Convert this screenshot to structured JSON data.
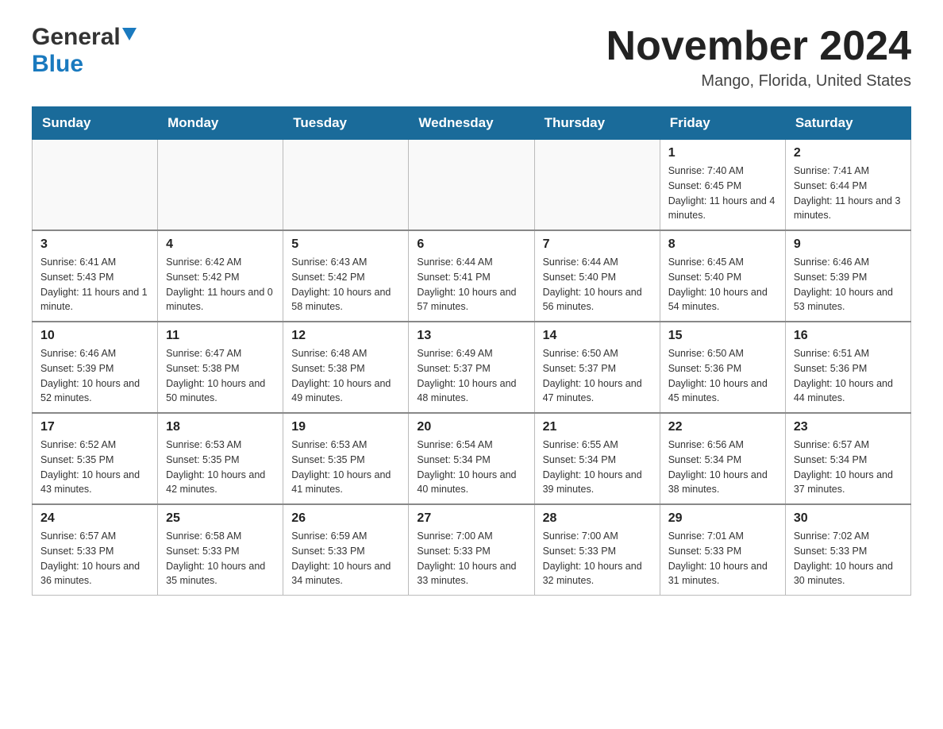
{
  "header": {
    "logo_general": "General",
    "logo_blue": "Blue",
    "month_title": "November 2024",
    "location": "Mango, Florida, United States"
  },
  "weekdays": [
    "Sunday",
    "Monday",
    "Tuesday",
    "Wednesday",
    "Thursday",
    "Friday",
    "Saturday"
  ],
  "rows": [
    [
      {
        "day": "",
        "info": ""
      },
      {
        "day": "",
        "info": ""
      },
      {
        "day": "",
        "info": ""
      },
      {
        "day": "",
        "info": ""
      },
      {
        "day": "",
        "info": ""
      },
      {
        "day": "1",
        "info": "Sunrise: 7:40 AM\nSunset: 6:45 PM\nDaylight: 11 hours and 4 minutes."
      },
      {
        "day": "2",
        "info": "Sunrise: 7:41 AM\nSunset: 6:44 PM\nDaylight: 11 hours and 3 minutes."
      }
    ],
    [
      {
        "day": "3",
        "info": "Sunrise: 6:41 AM\nSunset: 5:43 PM\nDaylight: 11 hours and 1 minute."
      },
      {
        "day": "4",
        "info": "Sunrise: 6:42 AM\nSunset: 5:42 PM\nDaylight: 11 hours and 0 minutes."
      },
      {
        "day": "5",
        "info": "Sunrise: 6:43 AM\nSunset: 5:42 PM\nDaylight: 10 hours and 58 minutes."
      },
      {
        "day": "6",
        "info": "Sunrise: 6:44 AM\nSunset: 5:41 PM\nDaylight: 10 hours and 57 minutes."
      },
      {
        "day": "7",
        "info": "Sunrise: 6:44 AM\nSunset: 5:40 PM\nDaylight: 10 hours and 56 minutes."
      },
      {
        "day": "8",
        "info": "Sunrise: 6:45 AM\nSunset: 5:40 PM\nDaylight: 10 hours and 54 minutes."
      },
      {
        "day": "9",
        "info": "Sunrise: 6:46 AM\nSunset: 5:39 PM\nDaylight: 10 hours and 53 minutes."
      }
    ],
    [
      {
        "day": "10",
        "info": "Sunrise: 6:46 AM\nSunset: 5:39 PM\nDaylight: 10 hours and 52 minutes."
      },
      {
        "day": "11",
        "info": "Sunrise: 6:47 AM\nSunset: 5:38 PM\nDaylight: 10 hours and 50 minutes."
      },
      {
        "day": "12",
        "info": "Sunrise: 6:48 AM\nSunset: 5:38 PM\nDaylight: 10 hours and 49 minutes."
      },
      {
        "day": "13",
        "info": "Sunrise: 6:49 AM\nSunset: 5:37 PM\nDaylight: 10 hours and 48 minutes."
      },
      {
        "day": "14",
        "info": "Sunrise: 6:50 AM\nSunset: 5:37 PM\nDaylight: 10 hours and 47 minutes."
      },
      {
        "day": "15",
        "info": "Sunrise: 6:50 AM\nSunset: 5:36 PM\nDaylight: 10 hours and 45 minutes."
      },
      {
        "day": "16",
        "info": "Sunrise: 6:51 AM\nSunset: 5:36 PM\nDaylight: 10 hours and 44 minutes."
      }
    ],
    [
      {
        "day": "17",
        "info": "Sunrise: 6:52 AM\nSunset: 5:35 PM\nDaylight: 10 hours and 43 minutes."
      },
      {
        "day": "18",
        "info": "Sunrise: 6:53 AM\nSunset: 5:35 PM\nDaylight: 10 hours and 42 minutes."
      },
      {
        "day": "19",
        "info": "Sunrise: 6:53 AM\nSunset: 5:35 PM\nDaylight: 10 hours and 41 minutes."
      },
      {
        "day": "20",
        "info": "Sunrise: 6:54 AM\nSunset: 5:34 PM\nDaylight: 10 hours and 40 minutes."
      },
      {
        "day": "21",
        "info": "Sunrise: 6:55 AM\nSunset: 5:34 PM\nDaylight: 10 hours and 39 minutes."
      },
      {
        "day": "22",
        "info": "Sunrise: 6:56 AM\nSunset: 5:34 PM\nDaylight: 10 hours and 38 minutes."
      },
      {
        "day": "23",
        "info": "Sunrise: 6:57 AM\nSunset: 5:34 PM\nDaylight: 10 hours and 37 minutes."
      }
    ],
    [
      {
        "day": "24",
        "info": "Sunrise: 6:57 AM\nSunset: 5:33 PM\nDaylight: 10 hours and 36 minutes."
      },
      {
        "day": "25",
        "info": "Sunrise: 6:58 AM\nSunset: 5:33 PM\nDaylight: 10 hours and 35 minutes."
      },
      {
        "day": "26",
        "info": "Sunrise: 6:59 AM\nSunset: 5:33 PM\nDaylight: 10 hours and 34 minutes."
      },
      {
        "day": "27",
        "info": "Sunrise: 7:00 AM\nSunset: 5:33 PM\nDaylight: 10 hours and 33 minutes."
      },
      {
        "day": "28",
        "info": "Sunrise: 7:00 AM\nSunset: 5:33 PM\nDaylight: 10 hours and 32 minutes."
      },
      {
        "day": "29",
        "info": "Sunrise: 7:01 AM\nSunset: 5:33 PM\nDaylight: 10 hours and 31 minutes."
      },
      {
        "day": "30",
        "info": "Sunrise: 7:02 AM\nSunset: 5:33 PM\nDaylight: 10 hours and 30 minutes."
      }
    ]
  ]
}
